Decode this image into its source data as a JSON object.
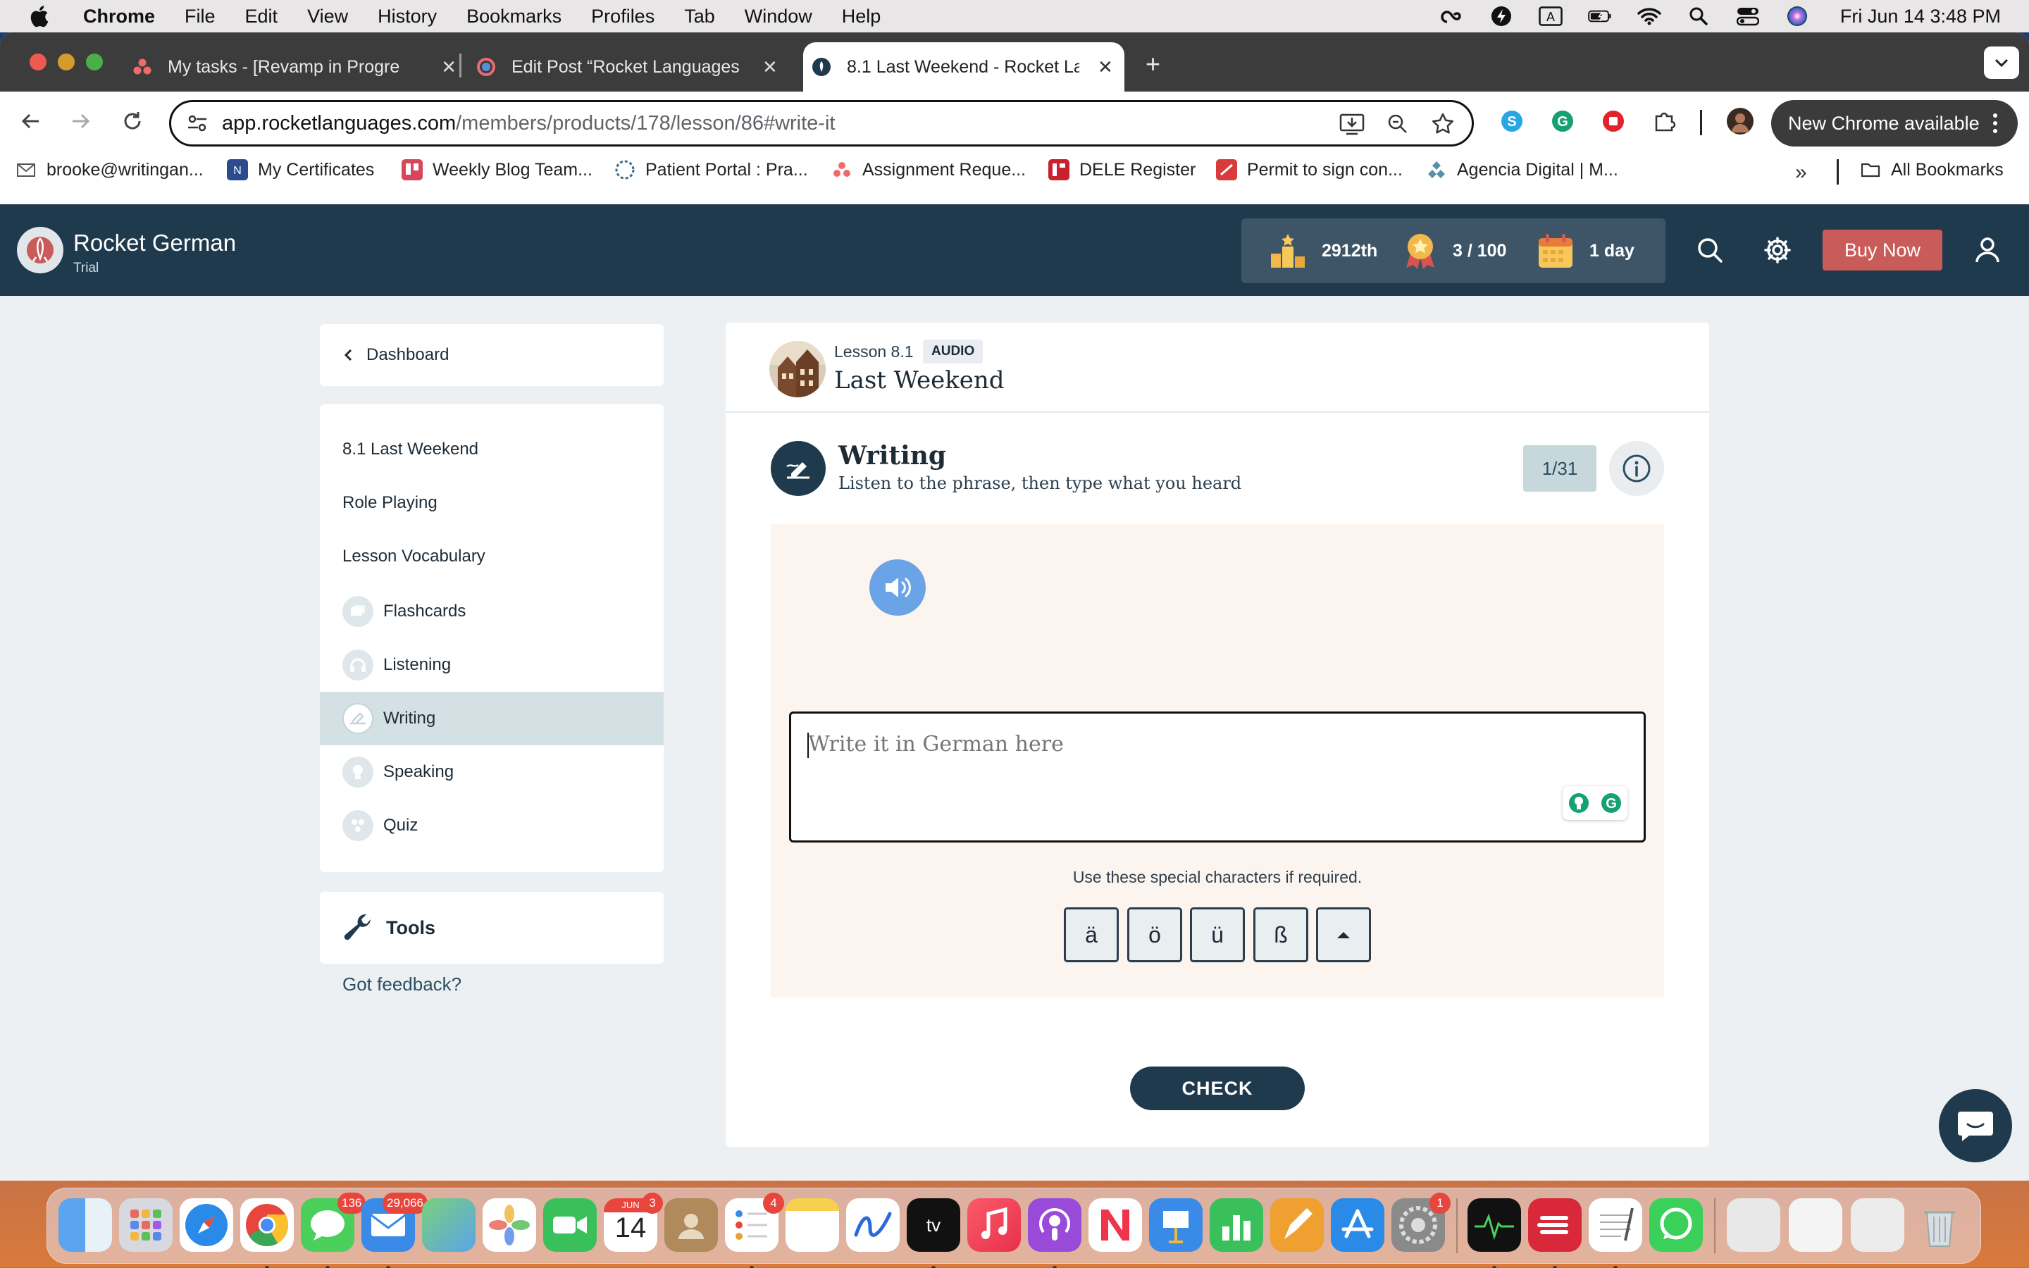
{
  "menubar": {
    "app_name": "Chrome",
    "items": [
      "File",
      "Edit",
      "View",
      "History",
      "Bookmarks",
      "Profiles",
      "Tab",
      "Window",
      "Help"
    ],
    "clock": "Fri Jun 14  3:48 PM",
    "status_icons": [
      "creative-cloud-icon",
      "bolt-icon",
      "input-source-icon",
      "battery-icon",
      "wifi-icon",
      "spotlight-icon",
      "control-center-icon",
      "siri-icon"
    ]
  },
  "browser": {
    "tabs": [
      {
        "title": "My tasks - [Revamp in Progre",
        "icon": "asana-icon"
      },
      {
        "title": "Edit Post “Rocket Languages",
        "icon": "wordpress-icon"
      },
      {
        "title": "8.1 Last Weekend - Rocket La",
        "icon": "rocket-languages-icon",
        "active": true
      }
    ],
    "url_host": "app.rocketlanguages.com",
    "url_path": "/members/products/178/lesson/86#write-it",
    "new_chrome_label": "New Chrome available",
    "bookmarks": [
      "brooke@writingan...",
      "My Certificates",
      "Weekly Blog Team...",
      "Patient Portal : Pra...",
      "Assignment Reque...",
      "DELE Register",
      "Permit to sign con...",
      "Agencia Digital | M..."
    ],
    "all_bookmarks_label": "All Bookmarks"
  },
  "app": {
    "brand": "Rocket German",
    "brand_sub": "Trial",
    "stats": {
      "rank": "2912th",
      "badges": "3 / 100",
      "streak": "1 day"
    },
    "buy_now": "Buy Now"
  },
  "sidebar": {
    "dashboard_label": "Dashboard",
    "items": [
      {
        "label": "8.1 Last Weekend",
        "icon": null
      },
      {
        "label": "Role Playing",
        "icon": null
      },
      {
        "label": "Lesson Vocabulary",
        "icon": null
      },
      {
        "label": "Flashcards",
        "icon": "flashcards-icon"
      },
      {
        "label": "Listening",
        "icon": "headphones-icon"
      },
      {
        "label": "Writing",
        "icon": "writing-hand-icon",
        "active": true
      },
      {
        "label": "Speaking",
        "icon": "lightbulb-icon"
      },
      {
        "label": "Quiz",
        "icon": "quiz-icon"
      }
    ],
    "tools_label": "Tools",
    "feedback_label": "Got feedback?"
  },
  "lesson": {
    "number": "Lesson 8.1",
    "badge": "AUDIO",
    "title": "Last Weekend"
  },
  "exercise": {
    "mode_title": "Writing",
    "mode_subtitle": "Listen to the phrase, then type what you heard",
    "progress": "1/31",
    "input_placeholder": "Write it in German here",
    "input_value": "",
    "special_label": "Use these special characters if required.",
    "special_chars": [
      "ä",
      "ö",
      "ü",
      "ß"
    ],
    "check_label": "CHECK"
  },
  "colors": {
    "header_bg": "#1f3a4d",
    "buy_now": "#c95b58",
    "exercise_bg": "#fbf4ef",
    "audio_btn": "#6ba4e6",
    "active_nav": "#d3e0e4"
  },
  "dock": {
    "apps": [
      {
        "name": "finder"
      },
      {
        "name": "launchpad"
      },
      {
        "name": "safari"
      },
      {
        "name": "chrome"
      },
      {
        "name": "messages",
        "badge": "136"
      },
      {
        "name": "mail",
        "badge": "29,066"
      },
      {
        "name": "maps"
      },
      {
        "name": "photos"
      },
      {
        "name": "facetime"
      },
      {
        "name": "calendar",
        "badge": "3",
        "month": "JUN",
        "day": "14"
      },
      {
        "name": "contacts"
      },
      {
        "name": "reminders",
        "badge": "4"
      },
      {
        "name": "notes"
      },
      {
        "name": "freeform"
      },
      {
        "name": "apple-tv",
        "label": "tv"
      },
      {
        "name": "music"
      },
      {
        "name": "podcasts"
      },
      {
        "name": "news"
      },
      {
        "name": "keynote"
      },
      {
        "name": "numbers"
      },
      {
        "name": "pages"
      },
      {
        "name": "app-store"
      },
      {
        "name": "system-settings",
        "badge": "1"
      },
      {
        "name": "activity-monitor"
      },
      {
        "name": "expressvpn"
      },
      {
        "name": "textedit"
      },
      {
        "name": "whatsapp"
      },
      {
        "name": "downloads-stack"
      },
      {
        "name": "documents-stack"
      },
      {
        "name": "trash"
      }
    ]
  }
}
